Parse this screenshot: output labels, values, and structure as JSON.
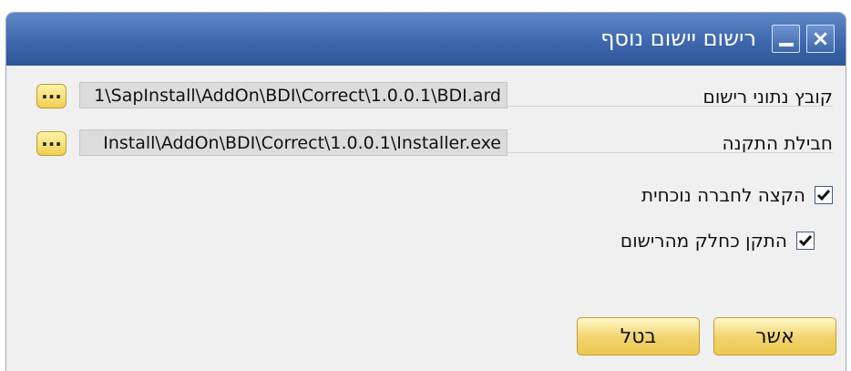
{
  "window": {
    "title": "רישום יישום נוסף",
    "minimize_icon": "minimize-icon",
    "close_icon": "close-icon"
  },
  "fields": [
    {
      "label": "קובץ נתוני רישום",
      "value": "1\\SapInstall\\AddOn\\BDI\\Correct\\1.0.0.1\\BDI.ard",
      "browse_label": "..."
    },
    {
      "label": "חבילת התקנה",
      "value": "‪Install\\AddOn\\BDI\\Correct\\1.0.0.1\\Installer.exe‬",
      "browse_label": "..."
    }
  ],
  "options": [
    {
      "label": "הקצה לחברה נוכחית",
      "checked": true
    },
    {
      "label": "התקן כחלק מהרישום",
      "checked": true
    }
  ],
  "buttons": {
    "ok": "אשר",
    "cancel": "בטל"
  },
  "colors": {
    "titlebar": "#3e68ad",
    "button_face": "#f2d46f",
    "button_border": "#c49b32"
  }
}
